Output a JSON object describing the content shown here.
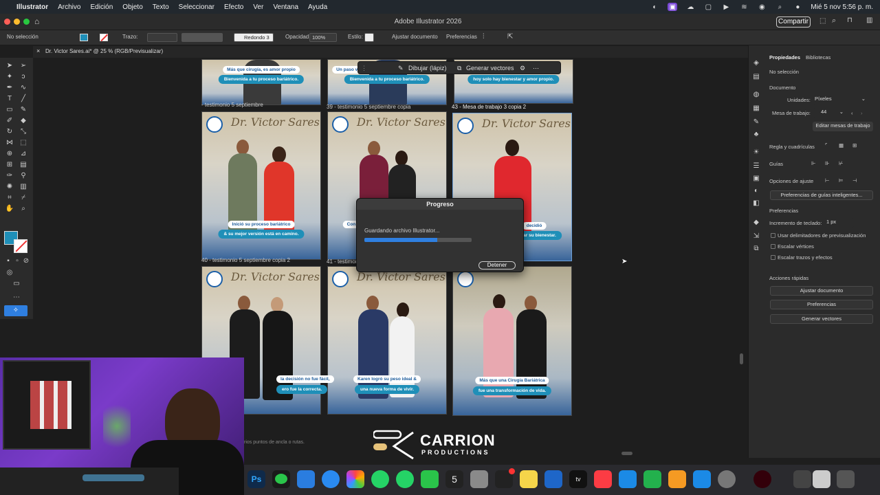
{
  "menubar": {
    "app": "Illustrator",
    "items": [
      "Archivo",
      "Edición",
      "Objeto",
      "Texto",
      "Seleccionar",
      "Efecto",
      "Ver",
      "Ventana",
      "Ayuda"
    ],
    "datetime": "Mié 5 nov  5:56 p. m."
  },
  "titlebar": {
    "title": "Adobe Illustrator 2026",
    "share": "Compartir"
  },
  "controlbar": {
    "selection": "No selección",
    "stroke_label": "Trazo:",
    "brush": "Redondo 3",
    "opacity_label": "Opacidad:",
    "opacity_value": "100%",
    "style_label": "Estilo:",
    "fit_doc": "Ajustar documento",
    "prefs": "Preferencias"
  },
  "doc_tab": {
    "name": "Dr. Victor Sares.ai* @ 25 % (RGB/Previsualizar)"
  },
  "context_bar": {
    "draw": "Dibujar (lápiz)",
    "vectors": "Generar vectores"
  },
  "artboards": {
    "brand": "Dr. Victor Sares",
    "top_captions": {
      "a1": "Más que cirugía, es amor propio",
      "a2": "Bienvenida a tu proceso bariátrico.",
      "b1": "Un paso valiente",
      "b2": "Bienvenida a tu proceso bariátrico.",
      "c1": "hoy solo hay bienestar y amor propio."
    },
    "labels": {
      "l1": "- testimonio 5 septiembre",
      "l2": "39 - testimonio 5 septiembre copia",
      "l3": "43 - Mesa de trabajo 3 copia 2",
      "l4": "40 - testimonio 5 septiembre copia 2",
      "l5": "41 - testimonio 5 septiembre copia 3"
    },
    "mid_captions": {
      "a1": "Inició su proceso bariátrico",
      "a2": "& su mejor versión está en camino.",
      "b2": "Con",
      "c1": "decidió",
      "c2": "ar su bienestar."
    },
    "bottom_captions": {
      "a1": "la decisión no fue fácil,",
      "a2": "ero fue la correcta.",
      "b1": "Karen logró su peso ideal &",
      "b2": "una nueva forma de vivir.",
      "c1": "Más que una Cirugía Bariátrica",
      "c2": "fue una transformación de vida."
    }
  },
  "dialog": {
    "title": "Progreso",
    "message": "Guardando archivo Illustrator...",
    "progress": 0.68,
    "stop": "Detener"
  },
  "panel": {
    "tabs": [
      "Propiedades",
      "Bibliotecas"
    ],
    "no_selection": "No selección",
    "document": "Documento",
    "units_label": "Unidades:",
    "units_value": "Píxeles",
    "artboard_label": "Mesa de trabajo:",
    "artboard_value": "44",
    "edit_artboards": "Editar mesas de trabajo",
    "rulers": "Regla y cuadrículas",
    "guides": "Guías",
    "snap": "Opciones de ajuste",
    "smart_guides": "Preferencias de guías inteligentes...",
    "preferences": "Preferencias",
    "keyboard_inc_label": "Incremento de teclado:",
    "keyboard_inc_value": "1 px",
    "cb1": "Usar delimitadores de previsualización",
    "cb2": "Escalar vértices",
    "cb3": "Escalar trazos y efectos",
    "quick_actions": "Acciones rápidas",
    "qa1": "Ajustar documento",
    "qa2": "Preferencias",
    "qa3": "Generar vectores"
  },
  "status": "rios puntos de ancla o rutas.",
  "watermark": {
    "line1": "CARRION",
    "line2": "PRODUCTIONS"
  },
  "colors": {
    "accent": "#2f7fe0",
    "caption_blue": "#1f8fb8",
    "fill_swatch": "#1f8fb8"
  }
}
